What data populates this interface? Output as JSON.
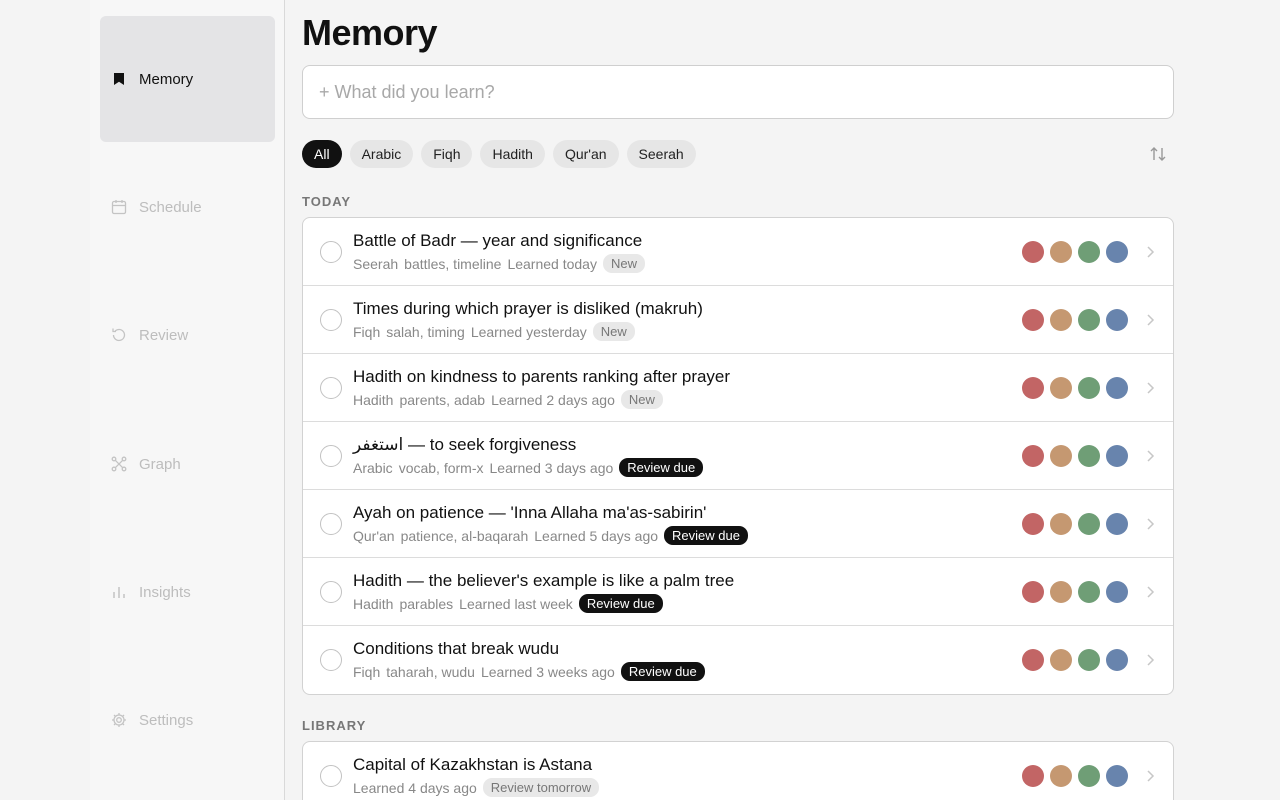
{
  "sidebar": {
    "items": [
      {
        "label": "Memory",
        "icon": "bookmark-icon",
        "active": true
      },
      {
        "label": "Schedule",
        "icon": "calendar-icon",
        "active": false
      },
      {
        "label": "Review",
        "icon": "refresh-icon",
        "active": false
      },
      {
        "label": "Graph",
        "icon": "graph-icon",
        "active": false
      },
      {
        "label": "Insights",
        "icon": "bar-chart-icon",
        "active": false
      },
      {
        "label": "Settings",
        "icon": "gear-icon",
        "active": false
      }
    ]
  },
  "main": {
    "title": "Memory",
    "input": {
      "placeholder": "+ What did you learn?",
      "value": ""
    },
    "filters": [
      "All",
      "Arabic",
      "Fiqh",
      "Hadith",
      "Qur'an",
      "Seerah"
    ],
    "active_filter": "All",
    "sort_icon": "sort-arrows-icon"
  },
  "colors": {
    "rating": [
      "#c26565",
      "#c59871",
      "#6f9e76",
      "#6884ad"
    ]
  },
  "sections": [
    {
      "label": "TODAY",
      "items": [
        {
          "title": "Battle of Badr — year and significance",
          "category": "Seerah",
          "tags": "battles, timeline",
          "learned": "Learned today",
          "badge": "New",
          "badge_type": "new"
        },
        {
          "title": "Times during which prayer is disliked (makruh)",
          "category": "Fiqh",
          "tags": "salah, timing",
          "learned": "Learned yesterday",
          "badge": "New",
          "badge_type": "new"
        },
        {
          "title": "Hadith on kindness to parents ranking after prayer",
          "category": "Hadith",
          "tags": "parents, adab",
          "learned": "Learned 2 days ago",
          "badge": "New",
          "badge_type": "new"
        },
        {
          "title": "استغفر — to seek forgiveness",
          "category": "Arabic",
          "tags": "vocab, form-x",
          "learned": "Learned 3 days ago",
          "badge": "Review due",
          "badge_type": "due"
        },
        {
          "title": "Ayah on patience — 'Inna Allaha ma'as-sabirin'",
          "category": "Qur'an",
          "tags": "patience, al-baqarah",
          "learned": "Learned 5 days ago",
          "badge": "Review due",
          "badge_type": "due"
        },
        {
          "title": "Hadith — the believer's example is like a palm tree",
          "category": "Hadith",
          "tags": "parables",
          "learned": "Learned last week",
          "badge": "Review due",
          "badge_type": "due"
        },
        {
          "title": "Conditions that break wudu",
          "category": "Fiqh",
          "tags": "taharah, wudu",
          "learned": "Learned 3 weeks ago",
          "badge": "Review due",
          "badge_type": "due"
        }
      ]
    },
    {
      "label": "LIBRARY",
      "items": [
        {
          "title": "Capital of Kazakhstan is Astana",
          "category": "",
          "tags": "",
          "learned": "Learned 4 days ago",
          "badge": "Review tomorrow",
          "badge_type": "tomorrow"
        }
      ]
    }
  ]
}
